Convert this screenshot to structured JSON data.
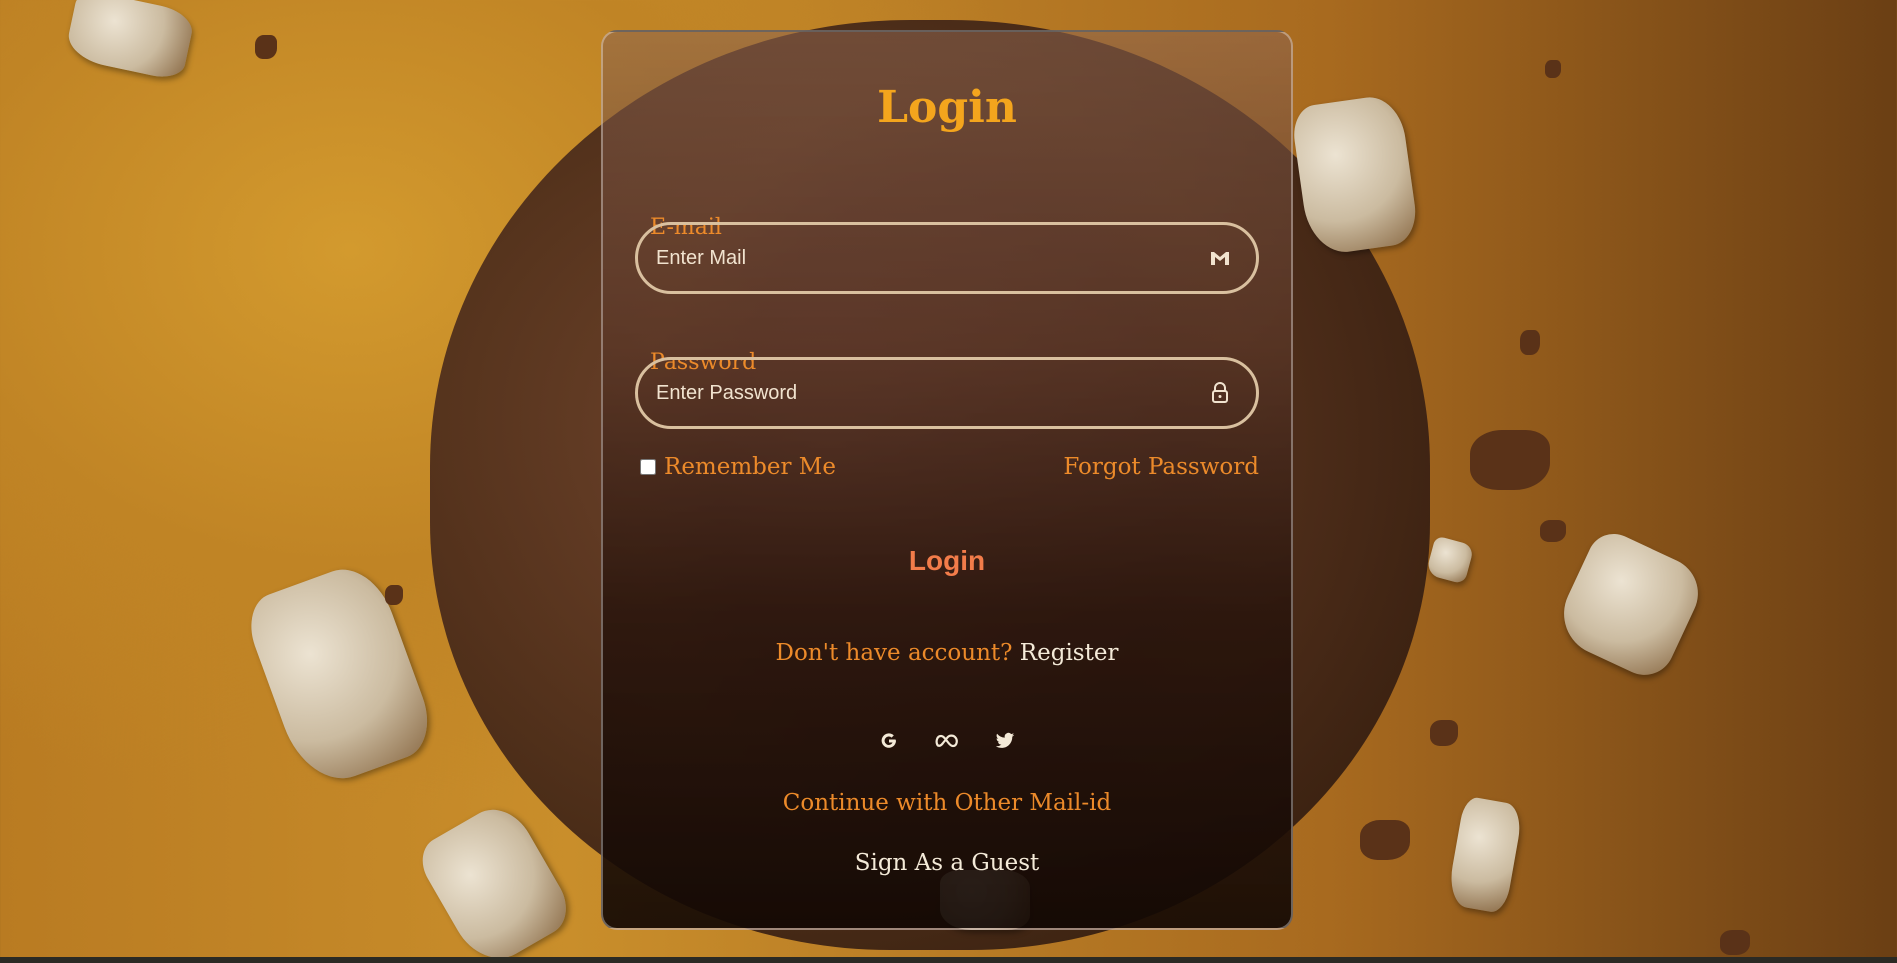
{
  "login": {
    "title": "Login",
    "email": {
      "label": "E-mail",
      "placeholder": "Enter Mail",
      "icon": "mail-icon"
    },
    "password": {
      "label": "Password",
      "placeholder": "Enter Password",
      "icon": "lock-icon"
    },
    "remember_label": "Remember Me",
    "forgot_label": "Forgot Password",
    "submit_label": "Login",
    "register_prompt": "Don't have account?",
    "register_link": "Register",
    "social_icons": [
      "google-icon",
      "meta-icon",
      "twitter-icon"
    ],
    "other_mail": "Continue with Other Mail-id",
    "guest": "Sign As a Guest"
  },
  "colors": {
    "accent_orange": "#ec8a2a",
    "title_gold": "#f4a51d",
    "button_coral": "#f27c4a",
    "light_text": "#f4ead8",
    "input_border": "#d9c09f"
  }
}
